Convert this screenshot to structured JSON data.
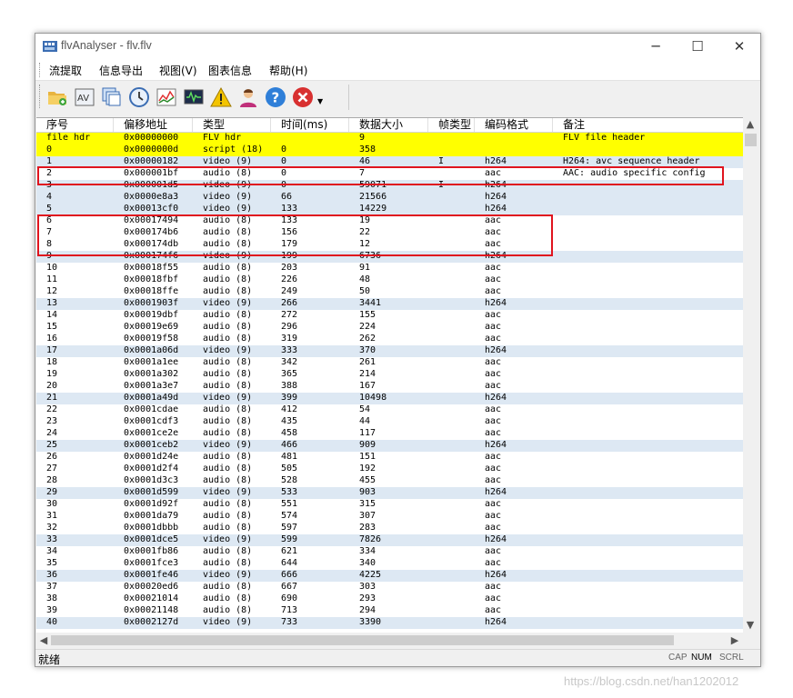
{
  "window": {
    "title": "flvAnalyser - flv.flv"
  },
  "menu": [
    "流提取",
    "信息导出",
    "视图(V)",
    "图表信息",
    "帮助(H)"
  ],
  "toolbar_icons": [
    "open-folder-icon",
    "av-icon",
    "pages-icon",
    "clock-icon",
    "wave-chart-icon",
    "bitrate-monitor-icon",
    "warning-icon",
    "user-icon",
    "help-icon",
    "close-circle-icon"
  ],
  "columns": [
    "序号",
    "偏移地址",
    "类型",
    "时间(ms)",
    "数据大小",
    "帧类型",
    "编码格式",
    "备注"
  ],
  "colors": {
    "highlight": "#ffff00",
    "alt": "#dde8f3",
    "annotation": "#e0141e"
  },
  "rows": [
    {
      "idx": "file hdr",
      "offset": "0x00000000",
      "type": "FLV hdr",
      "time": "",
      "size": "9",
      "frame": "",
      "codec": "",
      "note": "FLV file header",
      "style": "hl"
    },
    {
      "idx": "0",
      "offset": "0x0000000d",
      "type": "script (18)",
      "time": "0",
      "size": "358",
      "frame": "",
      "codec": "",
      "note": "",
      "style": "hl"
    },
    {
      "idx": "1",
      "offset": "0x00000182",
      "type": "video (9)",
      "time": "0",
      "size": "46",
      "frame": "I",
      "codec": "h264",
      "note": "H264: avc sequence header",
      "style": "alt"
    },
    {
      "idx": "2",
      "offset": "0x000001bf",
      "type": "audio (8)",
      "time": "0",
      "size": "7",
      "frame": "",
      "codec": "aac",
      "note": "AAC: audio specific config",
      "style": ""
    },
    {
      "idx": "3",
      "offset": "0x000001d5",
      "type": "video (9)",
      "time": "0",
      "size": "59071",
      "frame": "I",
      "codec": "h264",
      "note": "",
      "style": "alt"
    },
    {
      "idx": "4",
      "offset": "0x0000e8a3",
      "type": "video (9)",
      "time": "66",
      "size": "21566",
      "frame": "",
      "codec": "h264",
      "note": "",
      "style": "alt"
    },
    {
      "idx": "5",
      "offset": "0x00013cf0",
      "type": "video (9)",
      "time": "133",
      "size": "14229",
      "frame": "",
      "codec": "h264",
      "note": "",
      "style": "alt"
    },
    {
      "idx": "6",
      "offset": "0x00017494",
      "type": "audio (8)",
      "time": "133",
      "size": "19",
      "frame": "",
      "codec": "aac",
      "note": "",
      "style": ""
    },
    {
      "idx": "7",
      "offset": "0x000174b6",
      "type": "audio (8)",
      "time": "156",
      "size": "22",
      "frame": "",
      "codec": "aac",
      "note": "",
      "style": ""
    },
    {
      "idx": "8",
      "offset": "0x000174db",
      "type": "audio (8)",
      "time": "179",
      "size": "12",
      "frame": "",
      "codec": "aac",
      "note": "",
      "style": ""
    },
    {
      "idx": "9",
      "offset": "0x000174f6",
      "type": "video (9)",
      "time": "199",
      "size": "6736",
      "frame": "",
      "codec": "h264",
      "note": "",
      "style": "alt"
    },
    {
      "idx": "10",
      "offset": "0x00018f55",
      "type": "audio (8)",
      "time": "203",
      "size": "91",
      "frame": "",
      "codec": "aac",
      "note": "",
      "style": ""
    },
    {
      "idx": "11",
      "offset": "0x00018fbf",
      "type": "audio (8)",
      "time": "226",
      "size": "48",
      "frame": "",
      "codec": "aac",
      "note": "",
      "style": ""
    },
    {
      "idx": "12",
      "offset": "0x00018ffe",
      "type": "audio (8)",
      "time": "249",
      "size": "50",
      "frame": "",
      "codec": "aac",
      "note": "",
      "style": ""
    },
    {
      "idx": "13",
      "offset": "0x0001903f",
      "type": "video (9)",
      "time": "266",
      "size": "3441",
      "frame": "",
      "codec": "h264",
      "note": "",
      "style": "alt"
    },
    {
      "idx": "14",
      "offset": "0x00019dbf",
      "type": "audio (8)",
      "time": "272",
      "size": "155",
      "frame": "",
      "codec": "aac",
      "note": "",
      "style": ""
    },
    {
      "idx": "15",
      "offset": "0x00019e69",
      "type": "audio (8)",
      "time": "296",
      "size": "224",
      "frame": "",
      "codec": "aac",
      "note": "",
      "style": ""
    },
    {
      "idx": "16",
      "offset": "0x00019f58",
      "type": "audio (8)",
      "time": "319",
      "size": "262",
      "frame": "",
      "codec": "aac",
      "note": "",
      "style": ""
    },
    {
      "idx": "17",
      "offset": "0x0001a06d",
      "type": "video (9)",
      "time": "333",
      "size": "370",
      "frame": "",
      "codec": "h264",
      "note": "",
      "style": "alt"
    },
    {
      "idx": "18",
      "offset": "0x0001a1ee",
      "type": "audio (8)",
      "time": "342",
      "size": "261",
      "frame": "",
      "codec": "aac",
      "note": "",
      "style": ""
    },
    {
      "idx": "19",
      "offset": "0x0001a302",
      "type": "audio (8)",
      "time": "365",
      "size": "214",
      "frame": "",
      "codec": "aac",
      "note": "",
      "style": ""
    },
    {
      "idx": "20",
      "offset": "0x0001a3e7",
      "type": "audio (8)",
      "time": "388",
      "size": "167",
      "frame": "",
      "codec": "aac",
      "note": "",
      "style": ""
    },
    {
      "idx": "21",
      "offset": "0x0001a49d",
      "type": "video (9)",
      "time": "399",
      "size": "10498",
      "frame": "",
      "codec": "h264",
      "note": "",
      "style": "alt"
    },
    {
      "idx": "22",
      "offset": "0x0001cdae",
      "type": "audio (8)",
      "time": "412",
      "size": "54",
      "frame": "",
      "codec": "aac",
      "note": "",
      "style": ""
    },
    {
      "idx": "23",
      "offset": "0x0001cdf3",
      "type": "audio (8)",
      "time": "435",
      "size": "44",
      "frame": "",
      "codec": "aac",
      "note": "",
      "style": ""
    },
    {
      "idx": "24",
      "offset": "0x0001ce2e",
      "type": "audio (8)",
      "time": "458",
      "size": "117",
      "frame": "",
      "codec": "aac",
      "note": "",
      "style": ""
    },
    {
      "idx": "25",
      "offset": "0x0001ceb2",
      "type": "video (9)",
      "time": "466",
      "size": "909",
      "frame": "",
      "codec": "h264",
      "note": "",
      "style": "alt"
    },
    {
      "idx": "26",
      "offset": "0x0001d24e",
      "type": "audio (8)",
      "time": "481",
      "size": "151",
      "frame": "",
      "codec": "aac",
      "note": "",
      "style": ""
    },
    {
      "idx": "27",
      "offset": "0x0001d2f4",
      "type": "audio (8)",
      "time": "505",
      "size": "192",
      "frame": "",
      "codec": "aac",
      "note": "",
      "style": ""
    },
    {
      "idx": "28",
      "offset": "0x0001d3c3",
      "type": "audio (8)",
      "time": "528",
      "size": "455",
      "frame": "",
      "codec": "aac",
      "note": "",
      "style": ""
    },
    {
      "idx": "29",
      "offset": "0x0001d599",
      "type": "video (9)",
      "time": "533",
      "size": "903",
      "frame": "",
      "codec": "h264",
      "note": "",
      "style": "alt"
    },
    {
      "idx": "30",
      "offset": "0x0001d92f",
      "type": "audio (8)",
      "time": "551",
      "size": "315",
      "frame": "",
      "codec": "aac",
      "note": "",
      "style": ""
    },
    {
      "idx": "31",
      "offset": "0x0001da79",
      "type": "audio (8)",
      "time": "574",
      "size": "307",
      "frame": "",
      "codec": "aac",
      "note": "",
      "style": ""
    },
    {
      "idx": "32",
      "offset": "0x0001dbbb",
      "type": "audio (8)",
      "time": "597",
      "size": "283",
      "frame": "",
      "codec": "aac",
      "note": "",
      "style": ""
    },
    {
      "idx": "33",
      "offset": "0x0001dce5",
      "type": "video (9)",
      "time": "599",
      "size": "7826",
      "frame": "",
      "codec": "h264",
      "note": "",
      "style": "alt"
    },
    {
      "idx": "34",
      "offset": "0x0001fb86",
      "type": "audio (8)",
      "time": "621",
      "size": "334",
      "frame": "",
      "codec": "aac",
      "note": "",
      "style": ""
    },
    {
      "idx": "35",
      "offset": "0x0001fce3",
      "type": "audio (8)",
      "time": "644",
      "size": "340",
      "frame": "",
      "codec": "aac",
      "note": "",
      "style": ""
    },
    {
      "idx": "36",
      "offset": "0x0001fe46",
      "type": "video (9)",
      "time": "666",
      "size": "4225",
      "frame": "",
      "codec": "h264",
      "note": "",
      "style": "alt"
    },
    {
      "idx": "37",
      "offset": "0x00020ed6",
      "type": "audio (8)",
      "time": "667",
      "size": "303",
      "frame": "",
      "codec": "aac",
      "note": "",
      "style": ""
    },
    {
      "idx": "38",
      "offset": "0x00021014",
      "type": "audio (8)",
      "time": "690",
      "size": "293",
      "frame": "",
      "codec": "aac",
      "note": "",
      "style": ""
    },
    {
      "idx": "39",
      "offset": "0x00021148",
      "type": "audio (8)",
      "time": "713",
      "size": "294",
      "frame": "",
      "codec": "aac",
      "note": "",
      "style": ""
    },
    {
      "idx": "40",
      "offset": "0x0002127d",
      "type": "video (9)",
      "time": "733",
      "size": "3390",
      "frame": "",
      "codec": "h264",
      "note": "",
      "style": "alt"
    }
  ],
  "status": {
    "text": "就绪",
    "cap": "CAP",
    "num": "NUM",
    "scrl": "SCRL"
  },
  "watermark": "https://blog.csdn.net/han1202012"
}
